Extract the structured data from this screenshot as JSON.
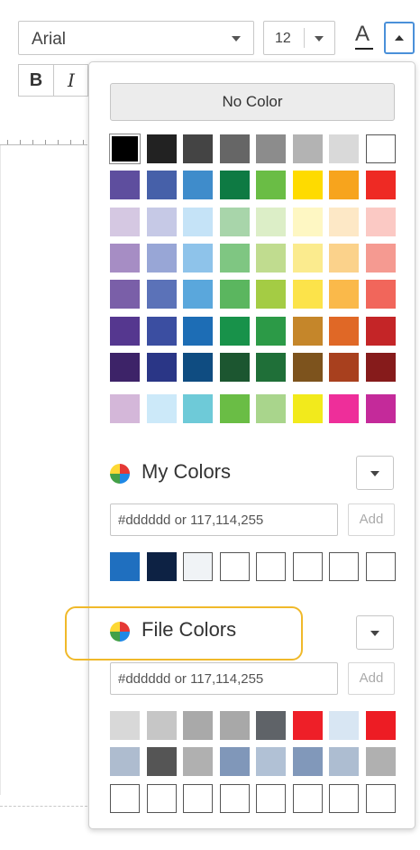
{
  "toolbar": {
    "font_family": "Arial",
    "font_size": "12",
    "text_color_glyph": "A",
    "bold_label": "B",
    "italic_label": "I"
  },
  "panel": {
    "no_color_label": "No Color",
    "palette": [
      [
        "#000000",
        "#222222",
        "#444444",
        "#666666",
        "#8c8c8c",
        "#b3b3b3",
        "#d9d9d9",
        "#ffffff"
      ],
      [
        "#5e4e9e",
        "#4660a9",
        "#3f8ccb",
        "#0e7a43",
        "#6abd45",
        "#fedb00",
        "#f7a41d",
        "#ee2a24"
      ],
      [
        "#d5c8e2",
        "#c6c9e6",
        "#c5e3f7",
        "#a8d5aa",
        "#dceec7",
        "#fef7c3",
        "#fde8c6",
        "#fbc9c4"
      ],
      [
        "#a68dc4",
        "#98a6d6",
        "#8ec3ea",
        "#7fc682",
        "#c0dc8f",
        "#fbeb8e",
        "#fbd28b",
        "#f59a91"
      ],
      [
        "#7a5fa8",
        "#5b72b8",
        "#5aa7dc",
        "#5bb65f",
        "#a4cc44",
        "#fce34a",
        "#fab94a",
        "#f1665b"
      ],
      [
        "#55378f",
        "#3b4ea1",
        "#1d6db5",
        "#18924a",
        "#2c9a47",
        "#c5862a",
        "#e06826",
        "#c42527"
      ],
      [
        "#3d2368",
        "#2a3686",
        "#0f4c81",
        "#1c5630",
        "#1f6f38",
        "#7d531d",
        "#a8401e",
        "#861b1b"
      ],
      [
        "#d4b7d9",
        "#cce9f9",
        "#6ecad8",
        "#6abd45",
        "#a9d58c",
        "#f2ea1c",
        "#ee2e9a",
        "#c42a9a"
      ]
    ],
    "my_colors": {
      "label": "My Colors",
      "icon": "color-wheel-icon",
      "input_placeholder": "#dddddd or 117,114,255",
      "add_label": "Add",
      "swatches": [
        "#1f6fbf",
        "#0d2244",
        "#f0f3f6",
        "#ffffff",
        "#ffffff",
        "#ffffff",
        "#ffffff",
        "#ffffff"
      ]
    },
    "file_colors": {
      "label": "File Colors",
      "icon": "color-wheel-icon",
      "input_placeholder": "#dddddd or 117,114,255",
      "add_label": "Add",
      "rows": [
        [
          "#d8d8d8",
          "#c6c6c6",
          "#a9a9a9",
          "#a8a8a8",
          "#5f6368",
          "#ee1f28",
          "#d8e6f3",
          "#ed1c24"
        ],
        [
          "#aebccf",
          "#555555",
          "#b0b0b0",
          "#8097b9",
          "#b1c1d5",
          "#8198ba",
          "#adbdd1",
          "#b0b0b0"
        ],
        [
          "#ffffff",
          "#ffffff",
          "#ffffff",
          "#ffffff",
          "#ffffff",
          "#ffffff",
          "#ffffff",
          "#ffffff"
        ]
      ]
    },
    "accent_colors": {
      "selected_border": "#4a90d9",
      "highlight": "#f0b92a"
    }
  }
}
